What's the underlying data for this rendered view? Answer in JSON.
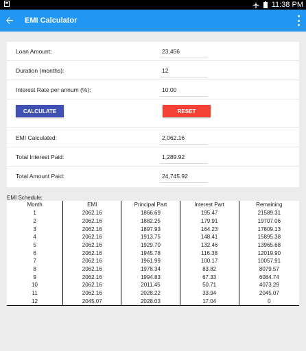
{
  "status_bar": {
    "time": "11:38 PM"
  },
  "app_bar": {
    "title": "EMI Calculator"
  },
  "form": {
    "loan_amount_label": "Loan Amount:",
    "loan_amount_value": "23,456",
    "duration_label": "Duration (months):",
    "duration_value": "12",
    "interest_label": "Interest Rate per annum (%):",
    "interest_value": "10.00",
    "calculate_label": "CALCULATE",
    "reset_label": "RESET",
    "emi_label": "EMI Calculated:",
    "emi_value": "2,062.16",
    "total_interest_label": "Total Interest Paid:",
    "total_interest_value": "1,289.92",
    "total_amount_label": "Total Amount Paid:",
    "total_amount_value": "24,745.92"
  },
  "schedule": {
    "label": "EMI Schedule:",
    "headers": [
      "Month",
      "EMI",
      "Principal Part",
      "Interest Part",
      "Remaining"
    ],
    "rows": [
      [
        "1",
        "2062.16",
        "1866.69",
        "195.47",
        "21589.31"
      ],
      [
        "2",
        "2062.16",
        "1882.25",
        "179.91",
        "19707.06"
      ],
      [
        "3",
        "2062.16",
        "1897.93",
        "164.23",
        "17809.13"
      ],
      [
        "4",
        "2062.16",
        "1913.75",
        "148.41",
        "15895.38"
      ],
      [
        "5",
        "2062.16",
        "1929.70",
        "132.46",
        "13965.68"
      ],
      [
        "6",
        "2062.16",
        "1945.78",
        "116.38",
        "12019.90"
      ],
      [
        "7",
        "2062.16",
        "1961.99",
        "100.17",
        "10057.91"
      ],
      [
        "8",
        "2062.16",
        "1978.34",
        "83.82",
        "8079.57"
      ],
      [
        "9",
        "2062.16",
        "1994.83",
        "67.33",
        "6084.74"
      ],
      [
        "10",
        "2062.16",
        "2011.45",
        "50.71",
        "4073.29"
      ],
      [
        "11",
        "2062.16",
        "2028.22",
        "33.94",
        "2045.07"
      ],
      [
        "12",
        "2045.07",
        "2028.03",
        "17.04",
        "0"
      ]
    ]
  },
  "colors": {
    "app_bar": "#2196f3",
    "calculate_button": "#3f51b5",
    "reset_button": "#f44336"
  }
}
